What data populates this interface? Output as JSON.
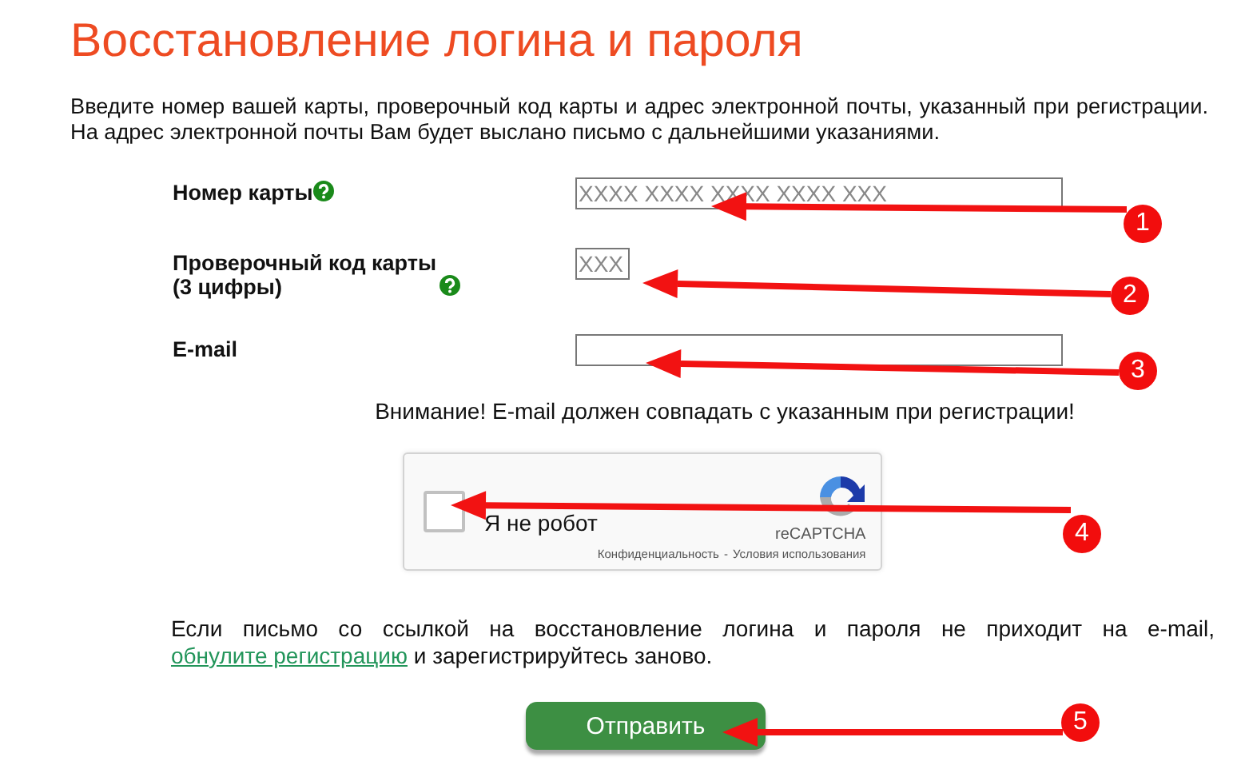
{
  "title": "Восстановление логина и пароля",
  "intro": "Введите номер вашей карты, проверочный код карты и адрес электронной почты, указанный при регистрации. На адрес электронной почты Вам будет выслано письмо с дальнейшими указаниями.",
  "fields": [
    {
      "label": "Номер карты",
      "help": true,
      "placeholder": "XXXX XXXX XXXX XXXX XXX",
      "kind": "long"
    },
    {
      "label": "Проверочный код карты (3 цифры)",
      "help": true,
      "placeholder": "XXX",
      "kind": "short"
    },
    {
      "label": "E-mail",
      "help": false,
      "kind": "long"
    }
  ],
  "warning": "Внимание! E-mail должен совпадать с указанным при регистрации!",
  "captcha": {
    "checkbox_label": "Я не робот",
    "checked": false,
    "brand": "reCAPTCHA",
    "links": [
      "Конфиденциальность",
      "Условия использования"
    ],
    "separator": "-"
  },
  "note": {
    "text": "Если письмо со ссылкой на восстановление логина и пароля не приходит на e-mail,",
    "link": "обнулите регистрацию",
    "after": "и зарегистрируйтесь заново."
  },
  "submit": "Отправить",
  "annotations": [
    {
      "number": "1"
    },
    {
      "number": "2"
    },
    {
      "number": "3"
    },
    {
      "number": "4"
    },
    {
      "number": "5"
    }
  ]
}
